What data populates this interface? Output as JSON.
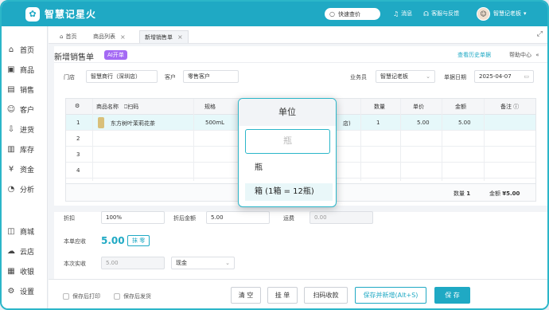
{
  "app": {
    "title": "智慧记星火",
    "logo_glyph": "✿"
  },
  "topbar": {
    "search_label": "快速查价",
    "messages": "消息",
    "support": "客服与反馈",
    "user": "智慧记老板"
  },
  "sidebar": {
    "items": [
      {
        "label": "首页",
        "icon": "home-icon",
        "glyph": "⌂"
      },
      {
        "label": "商品",
        "icon": "goods-icon",
        "glyph": "▣"
      },
      {
        "label": "销售",
        "icon": "sales-icon",
        "glyph": "▤"
      },
      {
        "label": "客户",
        "icon": "customer-icon",
        "glyph": "☺"
      },
      {
        "label": "进货",
        "icon": "purchase-icon",
        "glyph": "⇩"
      },
      {
        "label": "库存",
        "icon": "stock-icon",
        "glyph": "▥"
      },
      {
        "label": "资金",
        "icon": "funds-icon",
        "glyph": "¥"
      },
      {
        "label": "分析",
        "icon": "analysis-icon",
        "glyph": "◔"
      },
      {
        "label": "商城",
        "icon": "mall-icon",
        "glyph": "◫"
      },
      {
        "label": "云店",
        "icon": "cloud-store-icon",
        "glyph": "☁"
      },
      {
        "label": "收银",
        "icon": "cashier-icon",
        "glyph": "▦"
      },
      {
        "label": "设置",
        "icon": "settings-icon",
        "glyph": "⚙"
      }
    ]
  },
  "tabs": [
    {
      "label": "首页"
    },
    {
      "label": "商品列表"
    },
    {
      "label": "新增销售单"
    }
  ],
  "page": {
    "title": "新增销售单",
    "ai_badge": "AI开单",
    "history_link": "查看历史单据",
    "help": "帮助中心"
  },
  "form": {
    "store_label": "门店",
    "store_value": "智慧商行（深圳店）",
    "customer_label": "客户",
    "customer_value": "零售客户",
    "salesman_label": "业务员",
    "salesman_value": "智慧记老板",
    "date_label": "单据日期",
    "date_value": "2025-04-07"
  },
  "table": {
    "headers": [
      "商品名称",
      "扫码",
      "规格",
      "数量",
      "单价",
      "金额",
      "备注"
    ],
    "rows": [
      {
        "no": "1",
        "name": "东方树叶茉莉花茶",
        "spec": "500mL",
        "store_hint": "店)",
        "qty": "1",
        "price": "5.00",
        "amount": "5.00"
      },
      {
        "no": "2"
      },
      {
        "no": "3"
      },
      {
        "no": "4"
      }
    ],
    "footer_qty_label": "数量",
    "footer_qty": "1",
    "footer_amount_label": "金额",
    "footer_amount": "¥5.00"
  },
  "summary": {
    "discount_label": "折扣",
    "discount_value": "100%",
    "after_discount_label": "折后金额",
    "after_discount_value": "5.00",
    "shipping_label": "运费",
    "shipping_value": "0.00",
    "receivable_label": "本单应收",
    "receivable_value": "5.00",
    "erase_label": "抹 零",
    "actual_label": "本次实收",
    "actual_value": "5.00",
    "pay_method": "现金"
  },
  "bottombar": {
    "print_after_save": "保存后打印",
    "ship_after_save": "保存后发货",
    "clear": "清 空",
    "hang": "挂 单",
    "scan_pay": "扫码收款",
    "save_new": "保存并新增(Alt+S)",
    "save": "保 存"
  },
  "unit_popup": {
    "title": "单位",
    "placeholder": "瓶",
    "options": [
      "瓶",
      "箱 (1箱 = 12瓶)"
    ]
  },
  "colors": {
    "brand": "#1fa9c4",
    "ai_badge": "#a46af4",
    "selected_row": "#e6f8fa"
  }
}
